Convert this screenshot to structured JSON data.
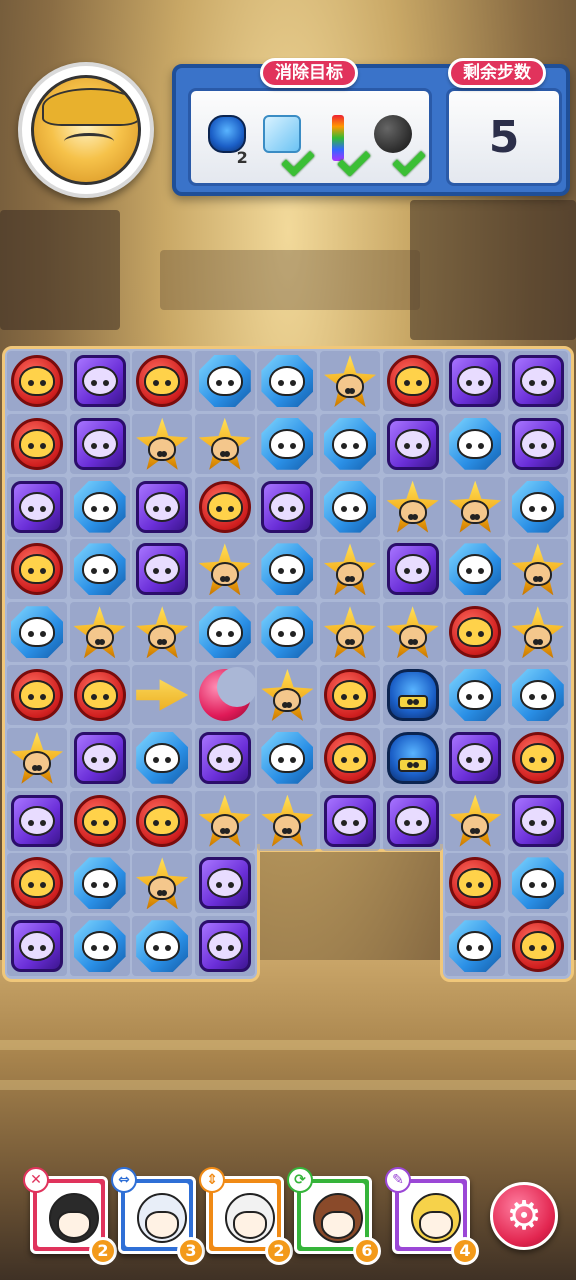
{
  "goal_panel": {
    "goals_label": "消除目标",
    "moves_label": "剩余步数",
    "moves_remaining": "5",
    "goals": [
      {
        "icon": "beetle-boss-icon",
        "count": "2",
        "done": false
      },
      {
        "icon": "ice-cube-icon",
        "count": "",
        "done": true
      },
      {
        "icon": "rainbow-bar-icon",
        "count": "",
        "done": true
      },
      {
        "icon": "bomb-icon",
        "count": "",
        "done": true
      }
    ]
  },
  "player": {
    "avatar": "yellow-hair-hero-avatar"
  },
  "board": {
    "columns": 9,
    "rows": 10,
    "grid": [
      [
        "red",
        "purple",
        "red",
        "blue",
        "blue",
        "yellow",
        "red",
        "purple",
        "purple"
      ],
      [
        "red",
        "purple",
        "yellow",
        "yellow",
        "blue",
        "blue",
        "purple",
        "blue",
        "purple"
      ],
      [
        "purple",
        "blue",
        "purple",
        "red",
        "purple",
        "blue",
        "yellow",
        "yellow",
        "blue"
      ],
      [
        "red",
        "blue",
        "purple",
        "yellow",
        "blue",
        "yellow",
        "purple",
        "blue",
        "yellow"
      ],
      [
        "blue",
        "yellow",
        "yellow",
        "blue",
        "blue",
        "yellow",
        "yellow",
        "red",
        "yellow"
      ],
      [
        "red",
        "red",
        "arrow",
        "moon",
        "yellow",
        "red",
        "boss",
        "blue",
        "blue"
      ],
      [
        "yellow",
        "purple",
        "blue",
        "purple",
        "blue",
        "red",
        "boss",
        "purple",
        "red"
      ],
      [
        "purple",
        "red",
        "red",
        "yellow",
        "yellow",
        "purple",
        "purple",
        "yellow",
        "purple"
      ],
      [
        "red",
        "blue",
        "yellow",
        "purple",
        "",
        "",
        "",
        "red",
        "blue"
      ],
      [
        "purple",
        "blue",
        "blue",
        "purple",
        "",
        "",
        "",
        "blue",
        "red"
      ]
    ]
  },
  "team": [
    {
      "name": "team-hero-1",
      "count": "2",
      "badge": "✕",
      "color": "#e0335c",
      "hair": "#2a2a2a"
    },
    {
      "name": "team-hero-2",
      "count": "3",
      "badge": "⇔",
      "color": "#2f6fd6",
      "hair": "#e8eef8"
    },
    {
      "name": "team-hero-3",
      "count": "2",
      "badge": "⇕",
      "color": "#f08a15",
      "hair": "#f2f2f2"
    },
    {
      "name": "team-hero-4",
      "count": "6",
      "badge": "⟳",
      "color": "#35b43a",
      "hair": "#8a4a2a"
    },
    {
      "name": "team-hero-5",
      "count": "4",
      "badge": "✎",
      "color": "#9b47d6",
      "hair": "#f6d24a"
    }
  ],
  "settings_icon": "gear-icon"
}
